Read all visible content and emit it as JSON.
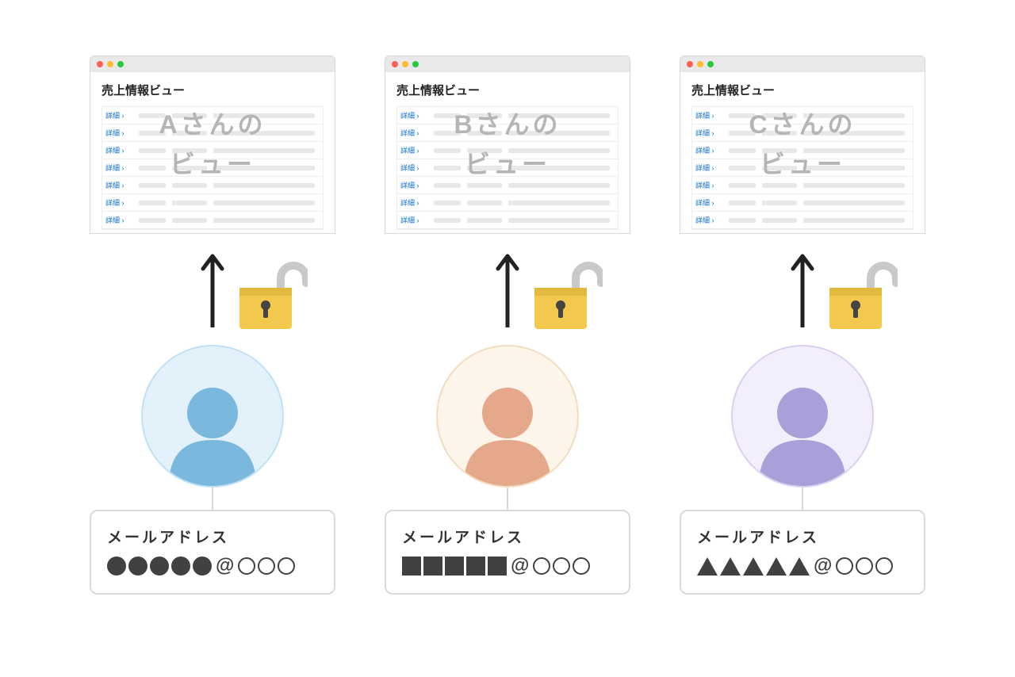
{
  "columns": [
    {
      "window_title": "売上情報ビュー",
      "row_link": "詳細",
      "overlay_line1": "Aさんの",
      "overlay_line2": "ビュー",
      "avatar_bg": "#e3f1fb",
      "avatar_ring": "#bfe1f6",
      "avatar_fg": "#7bb8de",
      "email_label": "メールアドレス",
      "mask_shape": "circle"
    },
    {
      "window_title": "売上情報ビュー",
      "row_link": "詳細",
      "overlay_line1": "Bさんの",
      "overlay_line2": "ビュー",
      "avatar_bg": "#fdf5ea",
      "avatar_ring": "#f4dcc0",
      "avatar_fg": "#e5a88b",
      "email_label": "メールアドレス",
      "mask_shape": "square"
    },
    {
      "window_title": "売上情報ビュー",
      "row_link": "詳細",
      "overlay_line1": "Cさんの",
      "overlay_line2": "ビュー",
      "avatar_bg": "#f2eefb",
      "avatar_ring": "#dcd0f2",
      "avatar_fg": "#a8a0d8",
      "email_label": "メールアドレス",
      "mask_shape": "triangle"
    }
  ],
  "lock_colors": {
    "body": "#f2c94c",
    "body_dark": "#e0b93e",
    "shackle": "#c9c9c9"
  }
}
